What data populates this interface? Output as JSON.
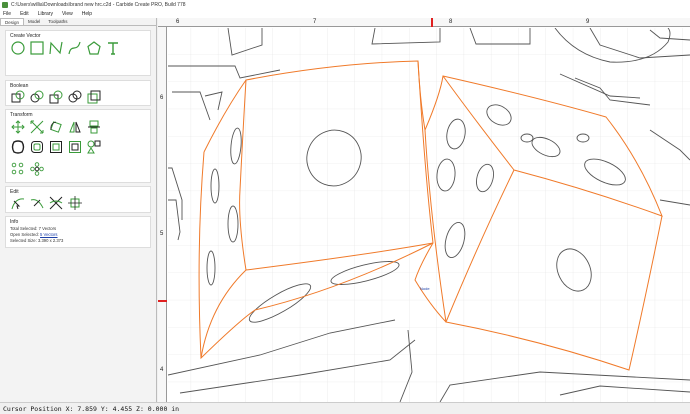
{
  "window": {
    "title": "C:\\Users\\willia\\Downloads\\brand new hrc.c2d - Carbide Create PRO, Build 778"
  },
  "menu": [
    "File",
    "Edit",
    "Library",
    "View",
    "Help"
  ],
  "tabs": [
    "Design",
    "Model",
    "Toolpaths"
  ],
  "sections": {
    "create_vector": "Create Vector",
    "boolean": "Boolean",
    "transform": "Transform",
    "edit": "Edit",
    "info": "Info"
  },
  "info": {
    "total_selected_label": "Total Selected:",
    "total_selected_value": "7 Vectors",
    "open_selected_label": "Open Selected:",
    "open_selected_value": "5 Vectors",
    "selected_size_label": "Selected Size:",
    "selected_size_value": "3.390 x 2.373"
  },
  "ruler": {
    "top_labels": [
      "6",
      "7",
      "8",
      "9"
    ],
    "left_labels": [
      "6",
      "5",
      "4"
    ]
  },
  "canvas": {
    "node_label": "Node"
  },
  "status": {
    "text": "Cursor Position X: 7.859 Y: 4.455 Z: 0.000 in"
  },
  "colors": {
    "selection": "#f07a2a",
    "vector": "#555555",
    "tool_icon": "#3a9b3a",
    "marker": "#e02020"
  }
}
